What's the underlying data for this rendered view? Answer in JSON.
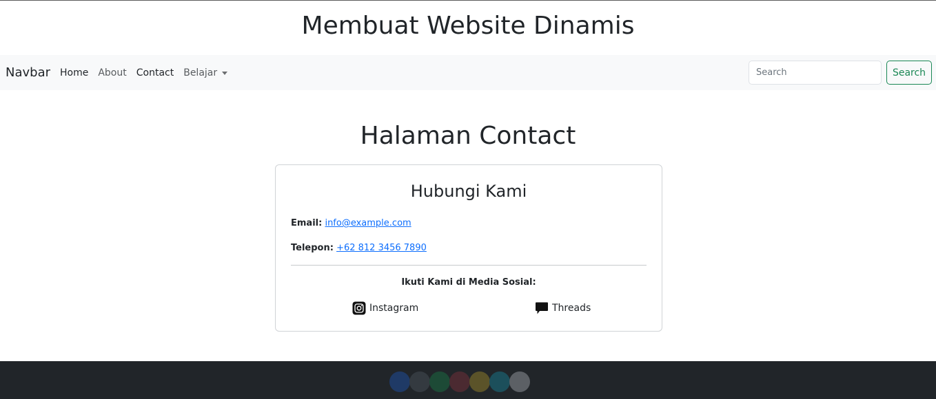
{
  "header": {
    "title": "Membuat Website Dinamis"
  },
  "navbar": {
    "brand": "Navbar",
    "links": [
      {
        "label": "Home"
      },
      {
        "label": "About"
      },
      {
        "label": "Contact"
      },
      {
        "label": "Belajar"
      }
    ],
    "search_placeholder": "Search",
    "search_button": "Search"
  },
  "main": {
    "heading": "Halaman Contact",
    "card": {
      "title": "Hubungi Kami",
      "email_label": "Email:",
      "email_value": "info@example.com",
      "phone_label": "Telepon:",
      "phone_value": "+62 812 3456 7890",
      "social_title": "Ikuti Kami di Media Sosial:",
      "social": [
        {
          "label": "Instagram",
          "icon": "instagram-icon"
        },
        {
          "label": "Threads",
          "icon": "chat-bubble-icon"
        }
      ]
    }
  },
  "footer": {
    "dot_colors": [
      "#1f3a66",
      "#343a40",
      "#1d4a36",
      "#4b2a31",
      "#5b5329",
      "#1c4f5b",
      "#5c6065"
    ]
  },
  "colors": {
    "accent_success": "#198754",
    "link": "#0d6efd",
    "navbar_bg": "#f8f9fa",
    "footer_bg": "#212529"
  }
}
